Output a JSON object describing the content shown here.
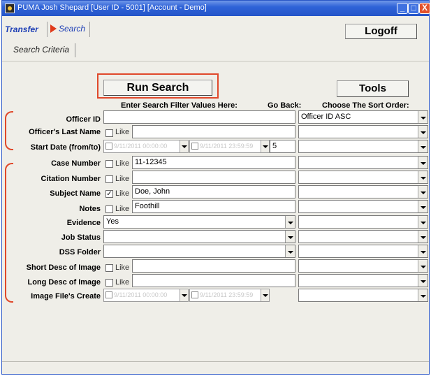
{
  "window": {
    "title": "PUMA  Josh Shepard [User ID - 5001] [Account - Demo]",
    "controls": {
      "minimize": "_",
      "maximize": "□",
      "close": "X"
    }
  },
  "tabs": {
    "transfer": "Transfer",
    "search": "Search"
  },
  "logoff_label": "Logoff",
  "subtab": "Search Criteria",
  "buttons": {
    "run_search": "Run Search",
    "tools": "Tools"
  },
  "headers": {
    "filter": "Enter Search Filter Values Here:",
    "goback": "Go Back:",
    "sort": "Choose The Sort Order:"
  },
  "like_label": "Like",
  "fields": {
    "officer_id": {
      "label": "Officer ID",
      "value": "",
      "sort": "Officer ID ASC"
    },
    "officer_last_name": {
      "label": "Officer's Last Name",
      "value": "",
      "sort": ""
    },
    "start_date": {
      "label": "Start Date (from/to)",
      "from": "9/11/2011 00:00:00",
      "to": "9/11/2011 23:59:59",
      "goback": "5",
      "sort": ""
    },
    "case_number": {
      "label": "Case Number",
      "value": "11-12345",
      "sort": ""
    },
    "citation_number": {
      "label": "Citation Number",
      "value": "",
      "sort": ""
    },
    "subject_name": {
      "label": "Subject Name",
      "value": "Doe, John",
      "like_checked": true,
      "sort": ""
    },
    "notes": {
      "label": "Notes",
      "value": "Foothill",
      "sort": ""
    },
    "evidence": {
      "label": "Evidence",
      "value": "Yes",
      "sort": ""
    },
    "job_status": {
      "label": "Job Status",
      "value": "",
      "sort": ""
    },
    "dss_folder": {
      "label": "DSS Folder",
      "value": "",
      "sort": ""
    },
    "short_desc": {
      "label": "Short Desc of Image",
      "value": "",
      "sort": ""
    },
    "long_desc": {
      "label": "Long Desc of Image",
      "value": "",
      "sort": ""
    },
    "image_create": {
      "label": "Image File's Create",
      "from": "9/11/2011 00:00:00",
      "to": "9/11/2011 23:59:59",
      "sort": ""
    }
  },
  "colors": {
    "title_bar": "#2f63d8",
    "tab_text": "#1e3fb5",
    "annotation": "#e0482a",
    "arrow": "#e03a1a"
  }
}
